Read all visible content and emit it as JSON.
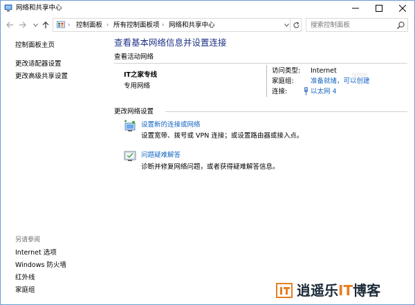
{
  "window": {
    "title": "网络和共享中心"
  },
  "address": {
    "crumbs": [
      "控制面板",
      "所有控制面板项",
      "网络和共享中心"
    ],
    "search_placeholder": "搜索控制面板"
  },
  "sidebar": {
    "items": [
      {
        "label": "控制面板主页"
      },
      {
        "label": "更改适配器设置"
      },
      {
        "label": "更改高级共享设置"
      }
    ],
    "see_also_label": "另请参阅",
    "see_also": [
      {
        "label": "Internet 选项"
      },
      {
        "label": "Windows 防火墙"
      },
      {
        "label": "红外线"
      },
      {
        "label": "家庭组"
      }
    ]
  },
  "main": {
    "title": "查看基本网络信息并设置连接",
    "active_networks_label": "查看活动网络",
    "network": {
      "name": "IT之家专线",
      "type": "专用网络",
      "access_type_label": "访问类型:",
      "access_type_value": "Internet",
      "homegroup_label": "家庭组:",
      "homegroup_value": "准备就绪，可以创建",
      "connections_label": "连接:",
      "connections_value": "以太网 4"
    },
    "change_settings_label": "更改网络设置",
    "tasks": [
      {
        "label": "设置新的连接或网络",
        "desc": "设置宽带、拨号或 VPN 连接；或设置路由器或接入点。"
      },
      {
        "label": "问题疑难解答",
        "desc": "诊断并修复网络问题，或者获得疑难解答信息。"
      }
    ]
  },
  "watermark": {
    "text_pre": "逍遥乐",
    "text_it": "IT",
    "text_post": "博客"
  },
  "colors": {
    "title_blue": "#1e3287",
    "link_blue": "#1566c0",
    "watermark_orange": "#e67e22"
  }
}
